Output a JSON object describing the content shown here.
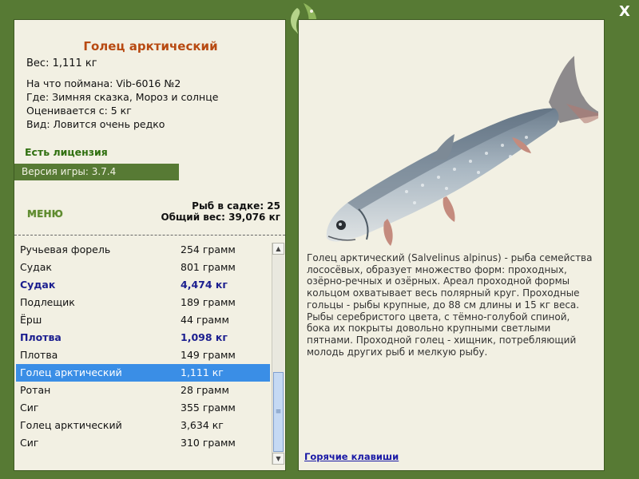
{
  "fish": {
    "name": "Голец арктический",
    "weight_line": "Вес: 1,111 кг",
    "caught_on": "На что поймана: Vib-6016 №2",
    "location": "Где: Зимняя сказка, Мороз и солнце",
    "valued_from": "Оценивается с: 5 кг",
    "rarity": "Вид: Ловится очень редко",
    "description": "Голец арктический (Salvelinus alpinus) - рыба семейства лососёвых, образует множество форм: проходных, озёрно-речных и озёрных. Ареал проходной формы кольцом охватывает весь полярный круг. Проходные гольцы - рыбы крупные, до 88 см длины и 15 кг веса. Рыбы серебристого цвета, с тёмно-голубой спиной, бока их покрыты довольно крупными светлыми пятнами. Проходной голец - хищник, потребляющий молодь других рыб и мелкую рыбу."
  },
  "license": "Есть лицензия",
  "version": "Версия игры: 3.7.4",
  "menu_label": "МЕНЮ",
  "cage": {
    "count_line": "Рыб в садке: 25",
    "total_line": "Общий вес: 39,076 кг"
  },
  "catch_list": [
    {
      "name": "Ручьевая форель",
      "weight": "254 грамм",
      "big": false,
      "selected": false
    },
    {
      "name": "Судак",
      "weight": "801 грамм",
      "big": false,
      "selected": false
    },
    {
      "name": "Судак",
      "weight": "4,474 кг",
      "big": true,
      "selected": false
    },
    {
      "name": "Подлещик",
      "weight": "189 грамм",
      "big": false,
      "selected": false
    },
    {
      "name": "Ёрш",
      "weight": "44 грамм",
      "big": false,
      "selected": false
    },
    {
      "name": "Плотва",
      "weight": "1,098 кг",
      "big": true,
      "selected": false
    },
    {
      "name": "Плотва",
      "weight": "149 грамм",
      "big": false,
      "selected": false
    },
    {
      "name": "Голец арктический",
      "weight": "1,111 кг",
      "big": false,
      "selected": true
    },
    {
      "name": "Ротан",
      "weight": "28 грамм",
      "big": false,
      "selected": false
    },
    {
      "name": "Сиг",
      "weight": "355 грамм",
      "big": false,
      "selected": false
    },
    {
      "name": "Голец арктический",
      "weight": "3,634 кг",
      "big": false,
      "selected": false
    },
    {
      "name": "Сиг",
      "weight": "310 грамм",
      "big": false,
      "selected": false
    }
  ],
  "hotkeys_label": "Горячие клавиши",
  "close_label": "X",
  "icons": {
    "close": "close-icon",
    "logo": "fish-logo-icon",
    "scroll_up": "scroll-up-arrow-icon",
    "scroll_down": "scroll-down-arrow-icon",
    "scroll_grip": "scroll-grip-icon"
  },
  "colors": {
    "frame": "#577a34",
    "panel": "#f2f0e3",
    "title": "#b84a12",
    "license": "#2f6f0f",
    "big_catch": "#1b1e8f",
    "selection": "#3a8ee6",
    "link": "#1a1aa6"
  }
}
